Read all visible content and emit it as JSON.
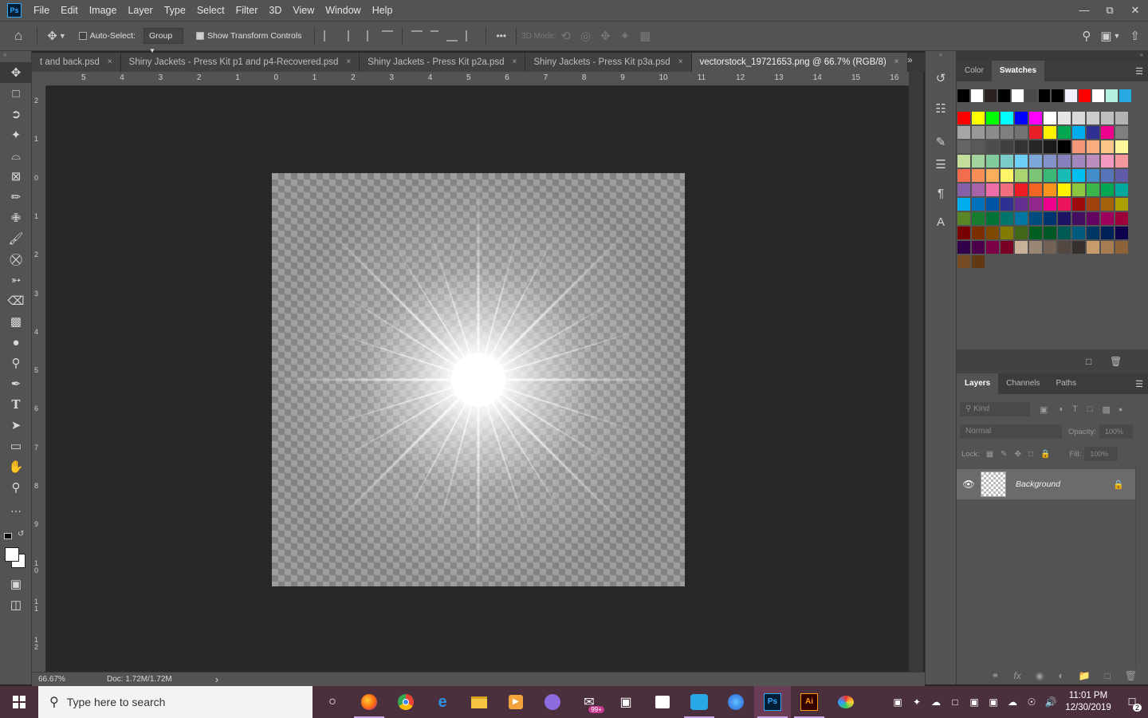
{
  "menubar": {
    "logo": "Ps",
    "items": [
      "File",
      "Edit",
      "Image",
      "Layer",
      "Type",
      "Select",
      "Filter",
      "3D",
      "View",
      "Window",
      "Help"
    ],
    "window_controls": [
      "minimize-icon",
      "restore-icon",
      "close-icon"
    ]
  },
  "options_bar": {
    "auto_select_label": "Auto-Select:",
    "auto_select_checked": false,
    "auto_select_value": "Group",
    "show_transform_label": "Show Transform Controls",
    "show_transform_checked": true,
    "more": "•••",
    "mode_3d_label": "3D Mode:"
  },
  "tabs": [
    {
      "label": "t and back.psd",
      "active": false
    },
    {
      "label": "Shiny Jackets - Press Kit p1 and p4-Recovered.psd",
      "active": false
    },
    {
      "label": "Shiny Jackets - Press Kit p2a.psd",
      "active": false
    },
    {
      "label": "Shiny Jackets - Press Kit p3a.psd",
      "active": false
    },
    {
      "label": "vectorstock_19721653.png @ 66.7% (RGB/8)",
      "active": true
    }
  ],
  "tab_close": "×",
  "ruler_top": [
    "5",
    "4",
    "3",
    "2",
    "1",
    "0",
    "1",
    "2",
    "3",
    "4",
    "5",
    "6",
    "7",
    "8",
    "9",
    "10",
    "11",
    "12",
    "13",
    "14",
    "15",
    "16"
  ],
  "ruler_left": [
    "2",
    "1",
    "0",
    "1",
    "2",
    "3",
    "4",
    "5",
    "6",
    "7",
    "8",
    "9",
    "1 0",
    "1 1",
    "1 2"
  ],
  "status": {
    "zoom": "66.67%",
    "doc": "Doc: 1.72M/1.72M",
    "arrow": "›"
  },
  "swatches_panel": {
    "tabs": [
      "Color",
      "Swatches"
    ],
    "active_tab": "Swatches",
    "recent": [
      "#000000",
      "#ffffff",
      "#2b2222",
      "#000000",
      "#ffffff",
      "#4a4a4a",
      "#000000",
      "#000000",
      "#f0f0ff",
      "#ff0000",
      "#ffffff",
      "#b3f0e0",
      "#29abe2"
    ],
    "rows": [
      [
        "#ff0000",
        "#ffff00",
        "#00ff00",
        "#00ffff",
        "#0000ff",
        "#ff00ff",
        "#ffffff",
        "#e6e6e6",
        "#d9d9d9",
        "#cccccc",
        "#bfbfbf",
        "#b3b3b3"
      ],
      [
        "#a6a6a6",
        "#999999",
        "#8c8c8c",
        "#808080",
        "#737373",
        "#e81f26",
        "#fff200",
        "#00a650",
        "#00aeef",
        "#2e3192",
        "#ec008c",
        "#7f7f7f"
      ],
      [
        "#666666",
        "#595959",
        "#4d4d4d",
        "#404040",
        "#333333",
        "#262626",
        "#1a1a1a",
        "#000000",
        "#f69679",
        "#f9ad81",
        "#fdc689",
        "#fff799"
      ],
      [
        "#c4df9b",
        "#a3d39c",
        "#82ca9c",
        "#7accc8",
        "#6dcff6",
        "#7da7d9",
        "#8393ca",
        "#8781bd",
        "#a187be",
        "#bd8cbf",
        "#f49ac1",
        "#f5989d"
      ],
      [
        "#f26c4f",
        "#f68e55",
        "#fbaf5c",
        "#fff467",
        "#acd372",
        "#7cc576",
        "#3bb878",
        "#1abbb4",
        "#00bff3",
        "#438cca",
        "#5574b9",
        "#605ca8"
      ],
      [
        "#855fa8",
        "#a763a8",
        "#f06eaa",
        "#f26d7d",
        "#ed1c24",
        "#f26522",
        "#f7941d",
        "#fff200",
        "#8dc63f",
        "#39b54a",
        "#00a651",
        "#00a99d"
      ],
      [
        "#00aeef",
        "#0072bc",
        "#0054a6",
        "#2e3192",
        "#662d91",
        "#92278f",
        "#ec008c",
        "#ed145b",
        "#9e0b0f",
        "#a0410d",
        "#a36209",
        "#aba000"
      ],
      [
        "#598527",
        "#197b30",
        "#007236",
        "#00746b",
        "#0076a3",
        "#004b80",
        "#003471",
        "#1b1464",
        "#440e62",
        "#630460",
        "#9e005d",
        "#9e0039"
      ],
      [
        "#790000",
        "#7b2e00",
        "#7d4900",
        "#827b00",
        "#406618",
        "#005e20",
        "#005826",
        "#005952",
        "#005b7f",
        "#003663",
        "#002157",
        "#0d004c"
      ],
      [
        "#32004b",
        "#4b0049",
        "#7b0046",
        "#7a0026",
        "#c7b299",
        "#998675",
        "#736357",
        "#534741",
        "#362f2d",
        "#c69c6d",
        "#a67c52",
        "#8c6239"
      ],
      [
        "#754c24",
        "#603913"
      ]
    ]
  },
  "layers_panel": {
    "tabs": [
      "Layers",
      "Channels",
      "Paths"
    ],
    "active_tab": "Layers",
    "kind_placeholder": "Kind",
    "blend_mode": "Normal",
    "opacity_label": "Opacity:",
    "opacity_value": "100%",
    "lock_label": "Lock:",
    "fill_label": "Fill:",
    "fill_value": "100%",
    "layers": [
      {
        "name": "Background",
        "visible": true,
        "locked": true
      }
    ]
  },
  "taskbar": {
    "search_placeholder": "Type here to search",
    "mail_badge": "99+",
    "time": "11:01 PM",
    "date": "12/30/2019",
    "notif_count": "2"
  }
}
